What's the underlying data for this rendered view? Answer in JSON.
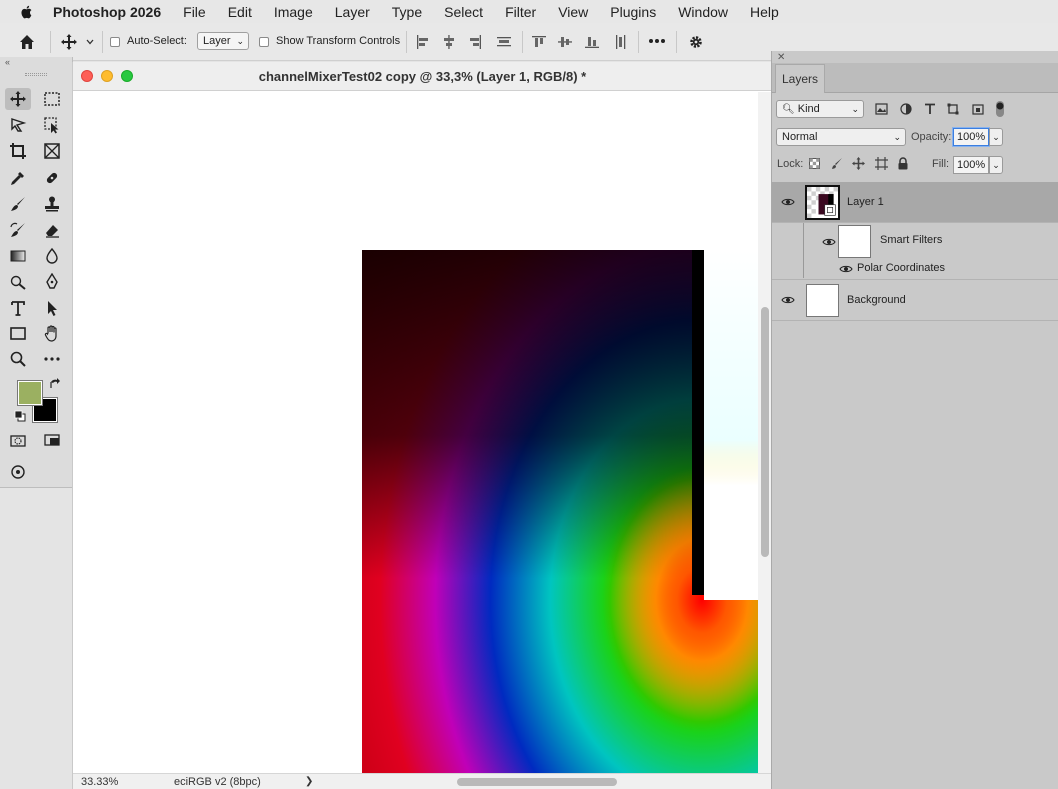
{
  "menubar": {
    "app_name": "Photoshop 2026",
    "items": [
      "File",
      "Edit",
      "Image",
      "Layer",
      "Type",
      "Select",
      "Filter",
      "View",
      "Plugins",
      "Window",
      "Help"
    ]
  },
  "options": {
    "auto_select_label": "Auto-Select:",
    "auto_select_value": "Layer",
    "show_transform_label": "Show Transform Controls"
  },
  "document": {
    "title": "channelMixerTest02 copy @ 33,3% (Layer 1, RGB/8) *",
    "zoom": "33.33%",
    "profile": "eciRGB v2 (8bpc)",
    "status_arrow": "❯"
  },
  "colors": {
    "foreground": "#9bb061",
    "background": "#000000"
  },
  "layers_panel": {
    "tab_label": "Layers",
    "filter_kind": "Kind",
    "blend_mode": "Normal",
    "opacity_label": "Opacity:",
    "opacity_value": "100%",
    "lock_label": "Lock:",
    "fill_label": "Fill:",
    "fill_value": "100%",
    "layers": [
      {
        "name": "Layer 1",
        "selected": true
      },
      {
        "name": "Smart Filters"
      },
      {
        "name": "Polar Coordinates"
      },
      {
        "name": "Background"
      }
    ]
  }
}
